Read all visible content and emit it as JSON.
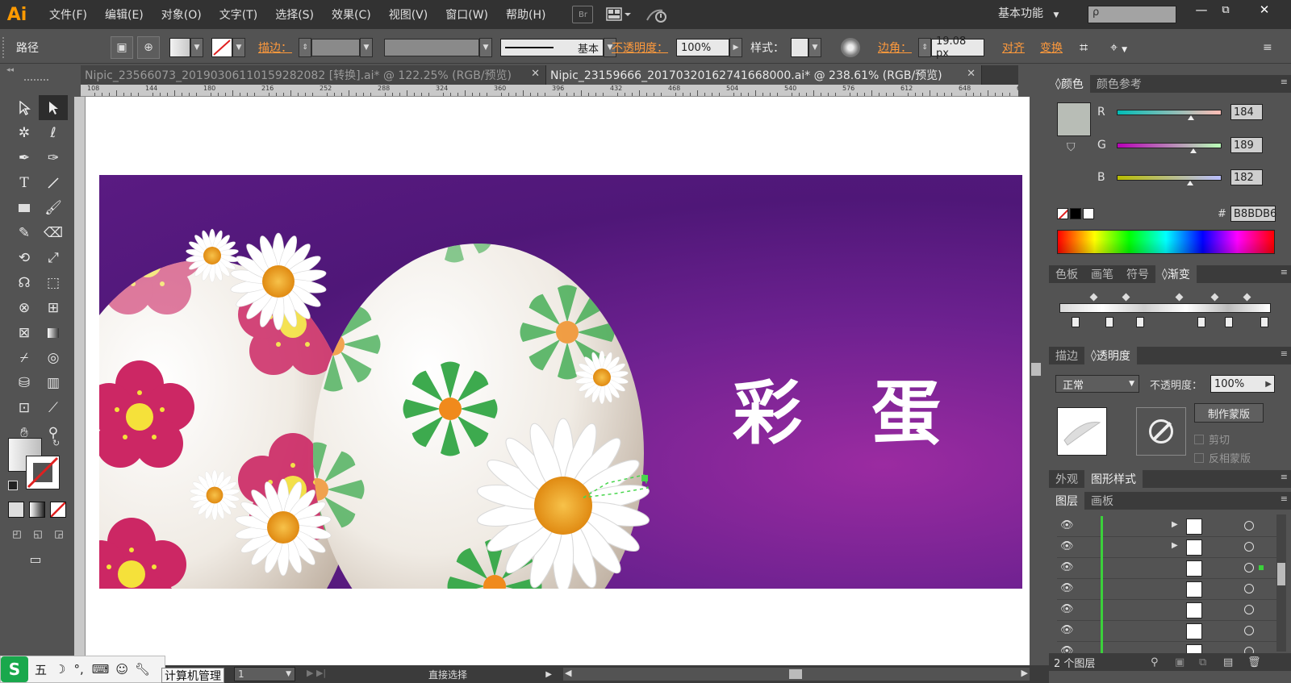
{
  "menubar": {
    "logo": "Ai",
    "items": [
      "文件(F)",
      "编辑(E)",
      "对象(O)",
      "文字(T)",
      "选择(S)",
      "效果(C)",
      "视图(V)",
      "窗口(W)",
      "帮助(H)"
    ],
    "bridge_label": "Br",
    "workspace": "基本功能",
    "search_placeholder": "ρ",
    "window_controls": [
      "—",
      "⧉",
      "✕"
    ]
  },
  "controlbar": {
    "selection_type": "路径",
    "stroke_label": "描边：",
    "stroke_style": "基本",
    "opacity_label": "不透明度：",
    "opacity_value": "100%",
    "style_label": "样式：",
    "corner_label": "边角：",
    "corner_value": "19.08 px",
    "align_label": "对齐",
    "transform_label": "变换"
  },
  "tabs": [
    {
      "label": "Nipic_23566073_20190306110159282082 [转换].ai* @ 122.25% (RGB/预览)",
      "active": false
    },
    {
      "label": "Nipic_23159666_20170320162741668000.ai* @ 238.61% (RGB/预览)",
      "active": true
    }
  ],
  "ruler_ticks": [
    "108",
    "144",
    "180",
    "216",
    "252",
    "288",
    "324",
    "360",
    "396",
    "432",
    "468",
    "504",
    "540",
    "576",
    "612",
    "648",
    "684"
  ],
  "artwork": {
    "title": "彩 蛋",
    "colors": {
      "bg_dark": "#4f1778",
      "bg_light": "#9b2ba1",
      "egg": "#efe9e1",
      "petal_green": "#3daa4e",
      "petal_pink": "#cc2764",
      "daisy": "#ffffff",
      "center": "#f2a21c"
    }
  },
  "color_panel": {
    "tabs": [
      "颜色",
      "颜色参考"
    ],
    "r": "184",
    "g": "189",
    "b": "182",
    "hex": "B8BDB6",
    "r_label": "R",
    "g_label": "G",
    "b_label": "B",
    "hash": "#",
    "swatch_color": "#b8bdb6"
  },
  "gradient_panel": {
    "tabs": [
      "色板",
      "画笔",
      "符号",
      "渐变"
    ]
  },
  "transparency_panel": {
    "tabs": [
      "描边",
      "透明度"
    ],
    "blend_mode": "正常",
    "opacity_label": "不透明度：",
    "opacity_value": "100%",
    "make_mask": "制作蒙版",
    "clip": "剪切",
    "invert": "反相蒙版"
  },
  "appearance_panel": {
    "tabs": [
      "外观",
      "图形样式"
    ]
  },
  "layers_panel": {
    "tabs": [
      "图层",
      "画板"
    ],
    "count_label": "2 个图层"
  },
  "statusbar": {
    "page": "1",
    "tool": "直接选择"
  },
  "ime": {
    "logo": "S",
    "mode": "五",
    "tooltip": "计算机管理"
  }
}
